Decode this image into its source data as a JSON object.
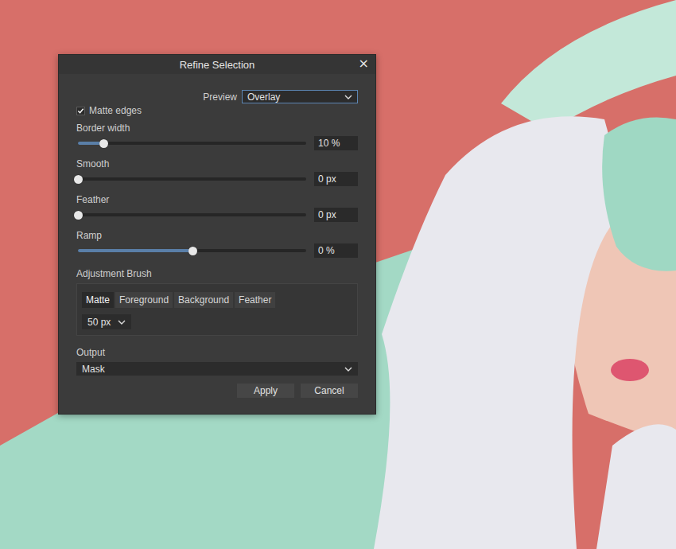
{
  "window": {
    "title": "Refine Selection",
    "close": "×"
  },
  "preview": {
    "label": "Preview",
    "value": "Overlay"
  },
  "matte_edges": {
    "label": "Matte edges",
    "checked": true
  },
  "sliders": [
    {
      "label": "Border width",
      "level": 0.11,
      "value": "10 %"
    },
    {
      "label": "Smooth",
      "level": 0,
      "value": "0 px"
    },
    {
      "label": "Feather",
      "level": 0,
      "value": "0 px"
    },
    {
      "label": "Ramp",
      "level": 0.5,
      "value": "0 %"
    }
  ],
  "adjustment_brush": {
    "label": "Adjustment Brush",
    "modes": [
      {
        "label": "Matte",
        "selected": true
      },
      {
        "label": "Foreground",
        "selected": false
      },
      {
        "label": "Background",
        "selected": false
      },
      {
        "label": "Feather",
        "selected": false
      }
    ],
    "size": "50 px"
  },
  "output": {
    "label": "Output",
    "value": "Mask"
  },
  "buttons": [
    "Apply",
    "Cancel"
  ]
}
